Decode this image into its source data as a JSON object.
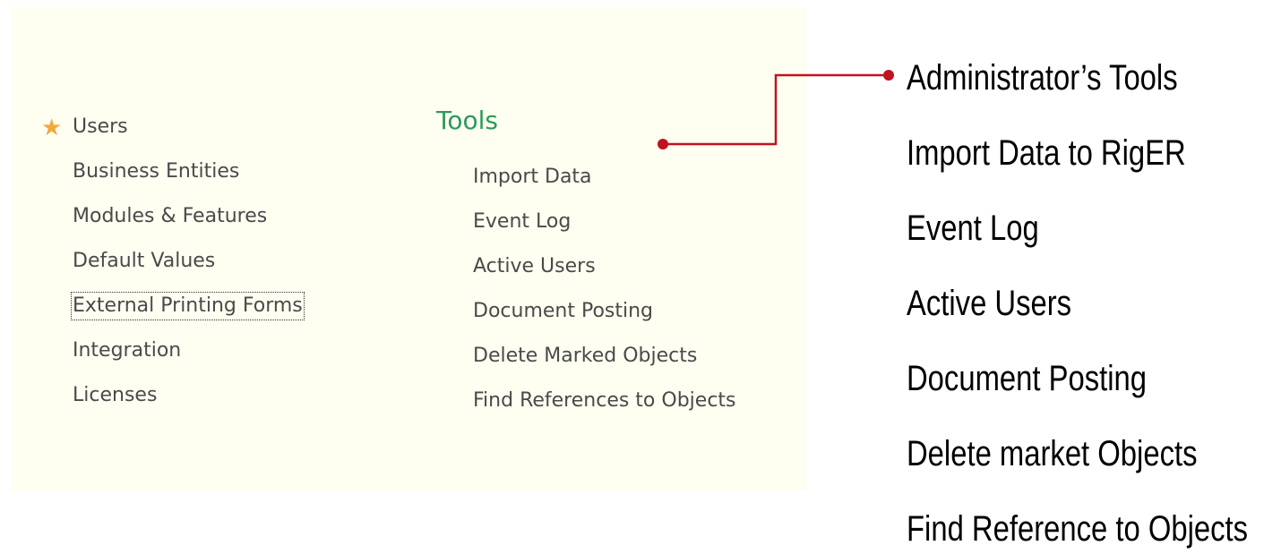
{
  "panel": {
    "left_items": [
      {
        "label": "Users",
        "favorite": true
      },
      {
        "label": "Business Entities"
      },
      {
        "label": "Modules & Features"
      },
      {
        "label": "Default Values"
      },
      {
        "label": "External Printing Forms",
        "focused": true
      },
      {
        "label": "Integration"
      },
      {
        "label": "Licenses"
      }
    ],
    "tools_heading": "Tools",
    "tools_items": [
      {
        "label": "Import Data"
      },
      {
        "label": "Event Log"
      },
      {
        "label": "Active Users"
      },
      {
        "label": "Document Posting"
      },
      {
        "label": "Delete Marked Objects"
      },
      {
        "label": "Find References to Objects"
      }
    ]
  },
  "annotations": {
    "items": [
      "Administrator’s Tools",
      "Import Data to RigER",
      "Event Log",
      "Active Users",
      "Document Posting",
      "Delete market Objects",
      "Find Reference to Objects"
    ],
    "connector_color": "#c0131e"
  },
  "colors": {
    "panel_bg": "#fefef1",
    "heading": "#2a9a5a",
    "link_text": "#4a4a4a",
    "star": "#f2a93b"
  },
  "icons": {
    "favorite": "star-icon"
  }
}
